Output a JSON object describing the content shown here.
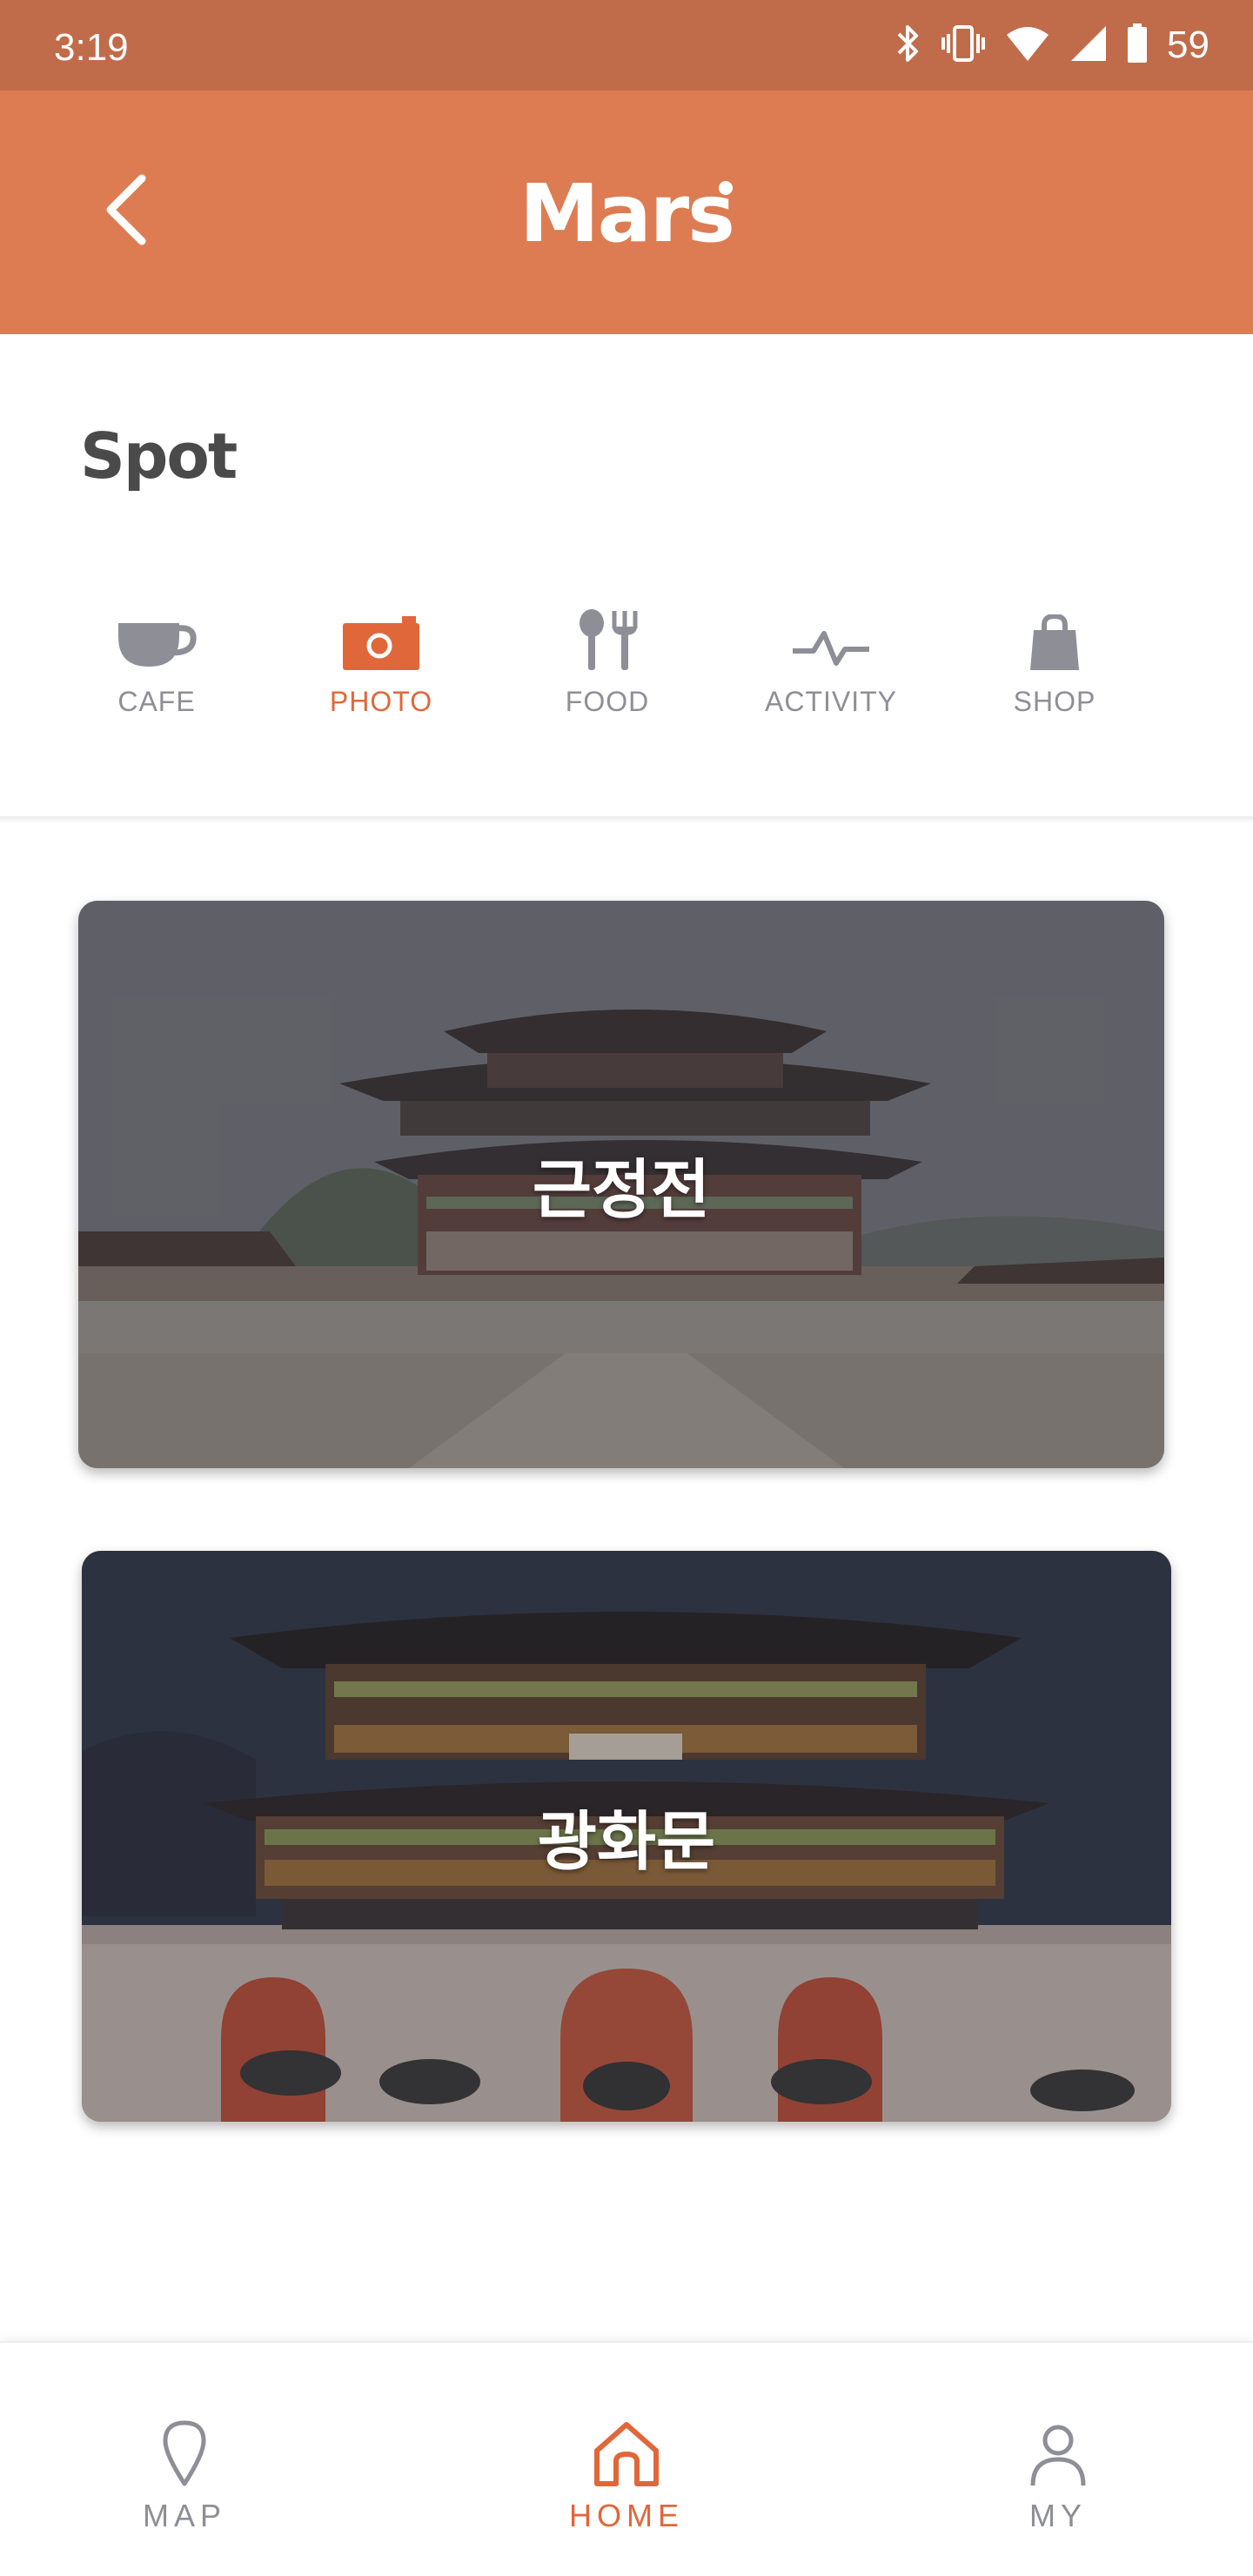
{
  "status_bar": {
    "time": "3:19",
    "battery_level": "59",
    "icons": [
      "bluetooth-icon",
      "vibrate-icon",
      "wifi-icon",
      "cell-signal-icon",
      "battery-icon"
    ]
  },
  "app_bar": {
    "title": "Mars",
    "back_icon": "back-arrow-icon",
    "background_color": "#dd7c52"
  },
  "section": {
    "title": "Spot"
  },
  "categories": [
    {
      "label": "CAFE",
      "icon": "coffee-cup-icon",
      "active": false
    },
    {
      "label": "PHOTO",
      "icon": "camera-icon",
      "active": true
    },
    {
      "label": "FOOD",
      "icon": "fork-knife-icon",
      "active": false
    },
    {
      "label": "ACTIVITY",
      "icon": "pulse-icon",
      "active": false
    },
    {
      "label": "SHOP",
      "icon": "shopping-bag-icon",
      "active": false
    }
  ],
  "spots": [
    {
      "name": "근정전"
    },
    {
      "name": "광화문"
    }
  ],
  "bottom_nav": [
    {
      "label": "MAP",
      "icon": "map-pin-icon",
      "active": false
    },
    {
      "label": "HOME",
      "icon": "home-icon",
      "active": true
    },
    {
      "label": "MY",
      "icon": "person-icon",
      "active": false
    }
  ],
  "colors": {
    "accent": "#e0673a",
    "status_bar": "#c06c4a",
    "inactive": "#8e8e97"
  }
}
